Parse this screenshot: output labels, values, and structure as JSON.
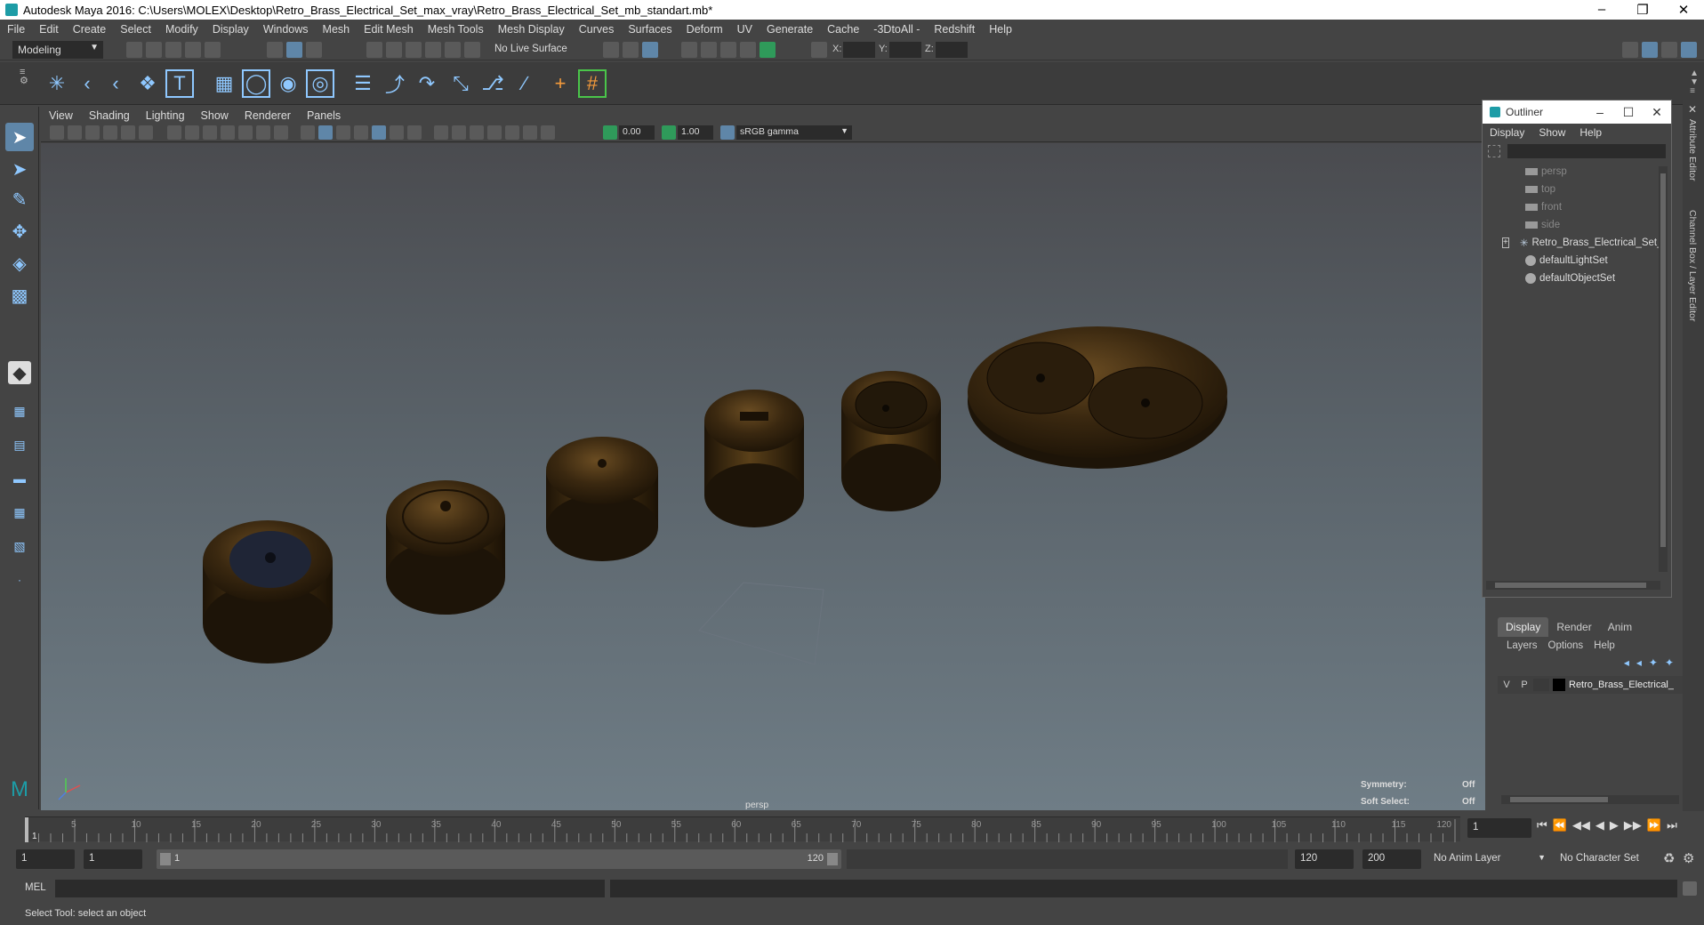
{
  "window": {
    "title": "Autodesk Maya 2016: C:\\Users\\MOLEX\\Desktop\\Retro_Brass_Electrical_Set_max_vray\\Retro_Brass_Electrical_Set_mb_standart.mb*"
  },
  "menu": [
    "File",
    "Edit",
    "Create",
    "Select",
    "Modify",
    "Display",
    "Windows",
    "Mesh",
    "Edit Mesh",
    "Mesh Tools",
    "Mesh Display",
    "Curves",
    "Surfaces",
    "Deform",
    "UV",
    "Generate",
    "Cache",
    "-3DtoAll -",
    "Redshift",
    "Help"
  ],
  "status": {
    "mode": "Modeling",
    "live_surface": "No Live Surface",
    "x_label": "X:",
    "y_label": "Y:",
    "z_label": "Z:"
  },
  "panel_menu": [
    "View",
    "Shading",
    "Lighting",
    "Show",
    "Renderer",
    "Panels"
  ],
  "panel_tools": {
    "value_a": "0.00",
    "value_b": "1.00",
    "color_space": "sRGB gamma"
  },
  "viewport": {
    "camera": "persp",
    "symmetry_label": "Symmetry:",
    "symmetry_value": "Off",
    "soft_select_label": "Soft Select:",
    "soft_select_value": "Off"
  },
  "outliner": {
    "title": "Outliner",
    "menu": [
      "Display",
      "Show",
      "Help"
    ],
    "items": [
      {
        "label": "persp",
        "dim": true,
        "icon": "camera-icon"
      },
      {
        "label": "top",
        "dim": true,
        "icon": "camera-icon"
      },
      {
        "label": "front",
        "dim": true,
        "icon": "camera-icon"
      },
      {
        "label": "side",
        "dim": true,
        "icon": "camera-icon"
      },
      {
        "label": "Retro_Brass_Electrical_Set_",
        "dim": false,
        "icon": "group-icon"
      },
      {
        "label": "defaultLightSet",
        "dim": false,
        "icon": "set-icon"
      },
      {
        "label": "defaultObjectSet",
        "dim": false,
        "icon": "set-icon"
      }
    ]
  },
  "layers": {
    "tabs": [
      "Display",
      "Render",
      "Anim"
    ],
    "menu": [
      "Layers",
      "Options",
      "Help"
    ],
    "row": {
      "v": "V",
      "p": "P",
      "name": "Retro_Brass_Electrical_"
    }
  },
  "timeline": {
    "ticks": [
      "5",
      "10",
      "15",
      "20",
      "25",
      "30",
      "35",
      "40",
      "45",
      "50",
      "55",
      "60",
      "65",
      "70",
      "75",
      "80",
      "85",
      "90",
      "95",
      "100",
      "105",
      "110",
      "115",
      "120"
    ],
    "start_tick": "1",
    "current_frame": "1"
  },
  "range": {
    "start": "1",
    "anim_start": "1",
    "slider_start": "1",
    "slider_end": "120",
    "end": "120",
    "anim_end": "200",
    "anim_layer": "No Anim Layer",
    "character_set": "No Character Set"
  },
  "command": {
    "label": "MEL"
  },
  "help": {
    "text": "Select Tool: select an object"
  },
  "right_strip": {
    "attribute_editor": "Attribute Editor",
    "channel_box": "Channel Box / Layer Editor"
  }
}
